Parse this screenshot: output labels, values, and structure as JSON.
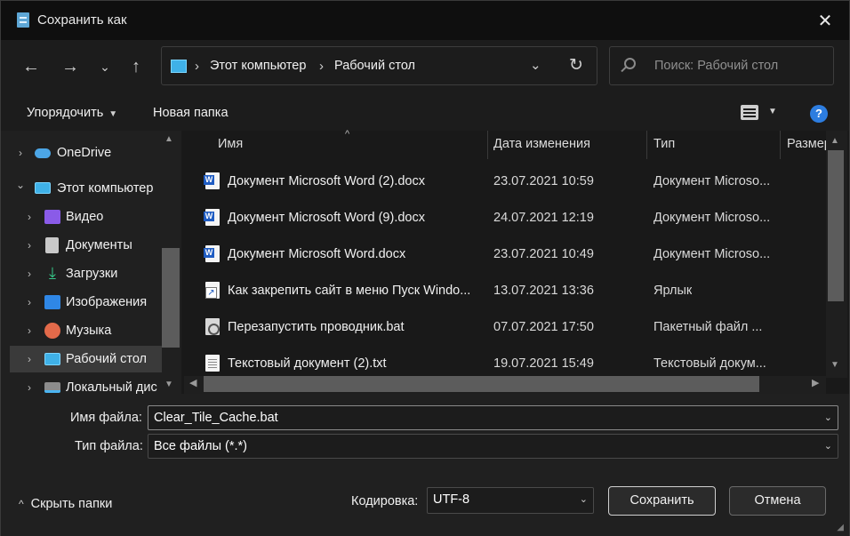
{
  "window": {
    "title": "Сохранить как",
    "close_label": "✕"
  },
  "nav": {
    "back_icon": "arrow-left-icon",
    "forward_icon": "arrow-right-icon",
    "recent_icon": "chevron-down-icon",
    "up_icon": "arrow-up-icon",
    "breadcrumb": [
      "Этот компьютер",
      "Рабочий стол"
    ],
    "search_placeholder": "Поиск: Рабочий стол"
  },
  "toolbar": {
    "organize_label": "Упорядочить",
    "new_folder_label": "Новая папка"
  },
  "sidebar": {
    "items": [
      {
        "label": "OneDrive",
        "icon": "onedrive-cloud-icon",
        "expander": "›"
      },
      {
        "label": "Этот компьютер",
        "icon": "this-pc-icon",
        "expander": "⌄"
      },
      {
        "label": "Видео",
        "icon": "videos-folder-icon",
        "expander": "›"
      },
      {
        "label": "Документы",
        "icon": "documents-folder-icon",
        "expander": "›"
      },
      {
        "label": "Загрузки",
        "icon": "downloads-folder-icon",
        "expander": "›"
      },
      {
        "label": "Изображения",
        "icon": "pictures-folder-icon",
        "expander": "›"
      },
      {
        "label": "Музыка",
        "icon": "music-folder-icon",
        "expander": "›"
      },
      {
        "label": "Рабочий стол",
        "icon": "desktop-folder-icon",
        "expander": "›",
        "selected": true
      },
      {
        "label": "Локальный дис",
        "icon": "local-disk-icon",
        "expander": "›"
      }
    ]
  },
  "columns": {
    "name": "Имя",
    "date": "Дата изменения",
    "type": "Тип",
    "size": "Размер"
  },
  "files": [
    {
      "name": "Документ Microsoft Word (2).docx",
      "date": "23.07.2021 10:59",
      "type": "Документ Microso...",
      "icon": "word-document-icon"
    },
    {
      "name": "Документ Microsoft Word (9).docx",
      "date": "24.07.2021 12:19",
      "type": "Документ Microso...",
      "icon": "word-document-icon"
    },
    {
      "name": "Документ Microsoft Word.docx",
      "date": "23.07.2021 10:49",
      "type": "Документ Microso...",
      "icon": "word-document-icon"
    },
    {
      "name": "Как закрепить сайт в меню Пуск Windo...",
      "date": "13.07.2021 13:36",
      "type": "Ярлык",
      "icon": "shortcut-icon"
    },
    {
      "name": "Перезапустить проводник.bat",
      "date": "07.07.2021 17:50",
      "type": "Пакетный файл ...",
      "icon": "batch-file-icon"
    },
    {
      "name": "Текстовый документ (2).txt",
      "date": "19.07.2021 15:49",
      "type": "Текстовый докум...",
      "icon": "text-document-icon"
    }
  ],
  "form": {
    "filename_label": "Имя файла:",
    "filename_value": "Clear_Tile_Cache.bat",
    "filetype_label": "Тип файла:",
    "filetype_value": "Все файлы (*.*)",
    "encoding_label": "Кодировка:",
    "encoding_value": "UTF-8"
  },
  "footer": {
    "hide_folders_label": "Скрыть папки",
    "save_label": "Сохранить",
    "cancel_label": "Отмена"
  }
}
